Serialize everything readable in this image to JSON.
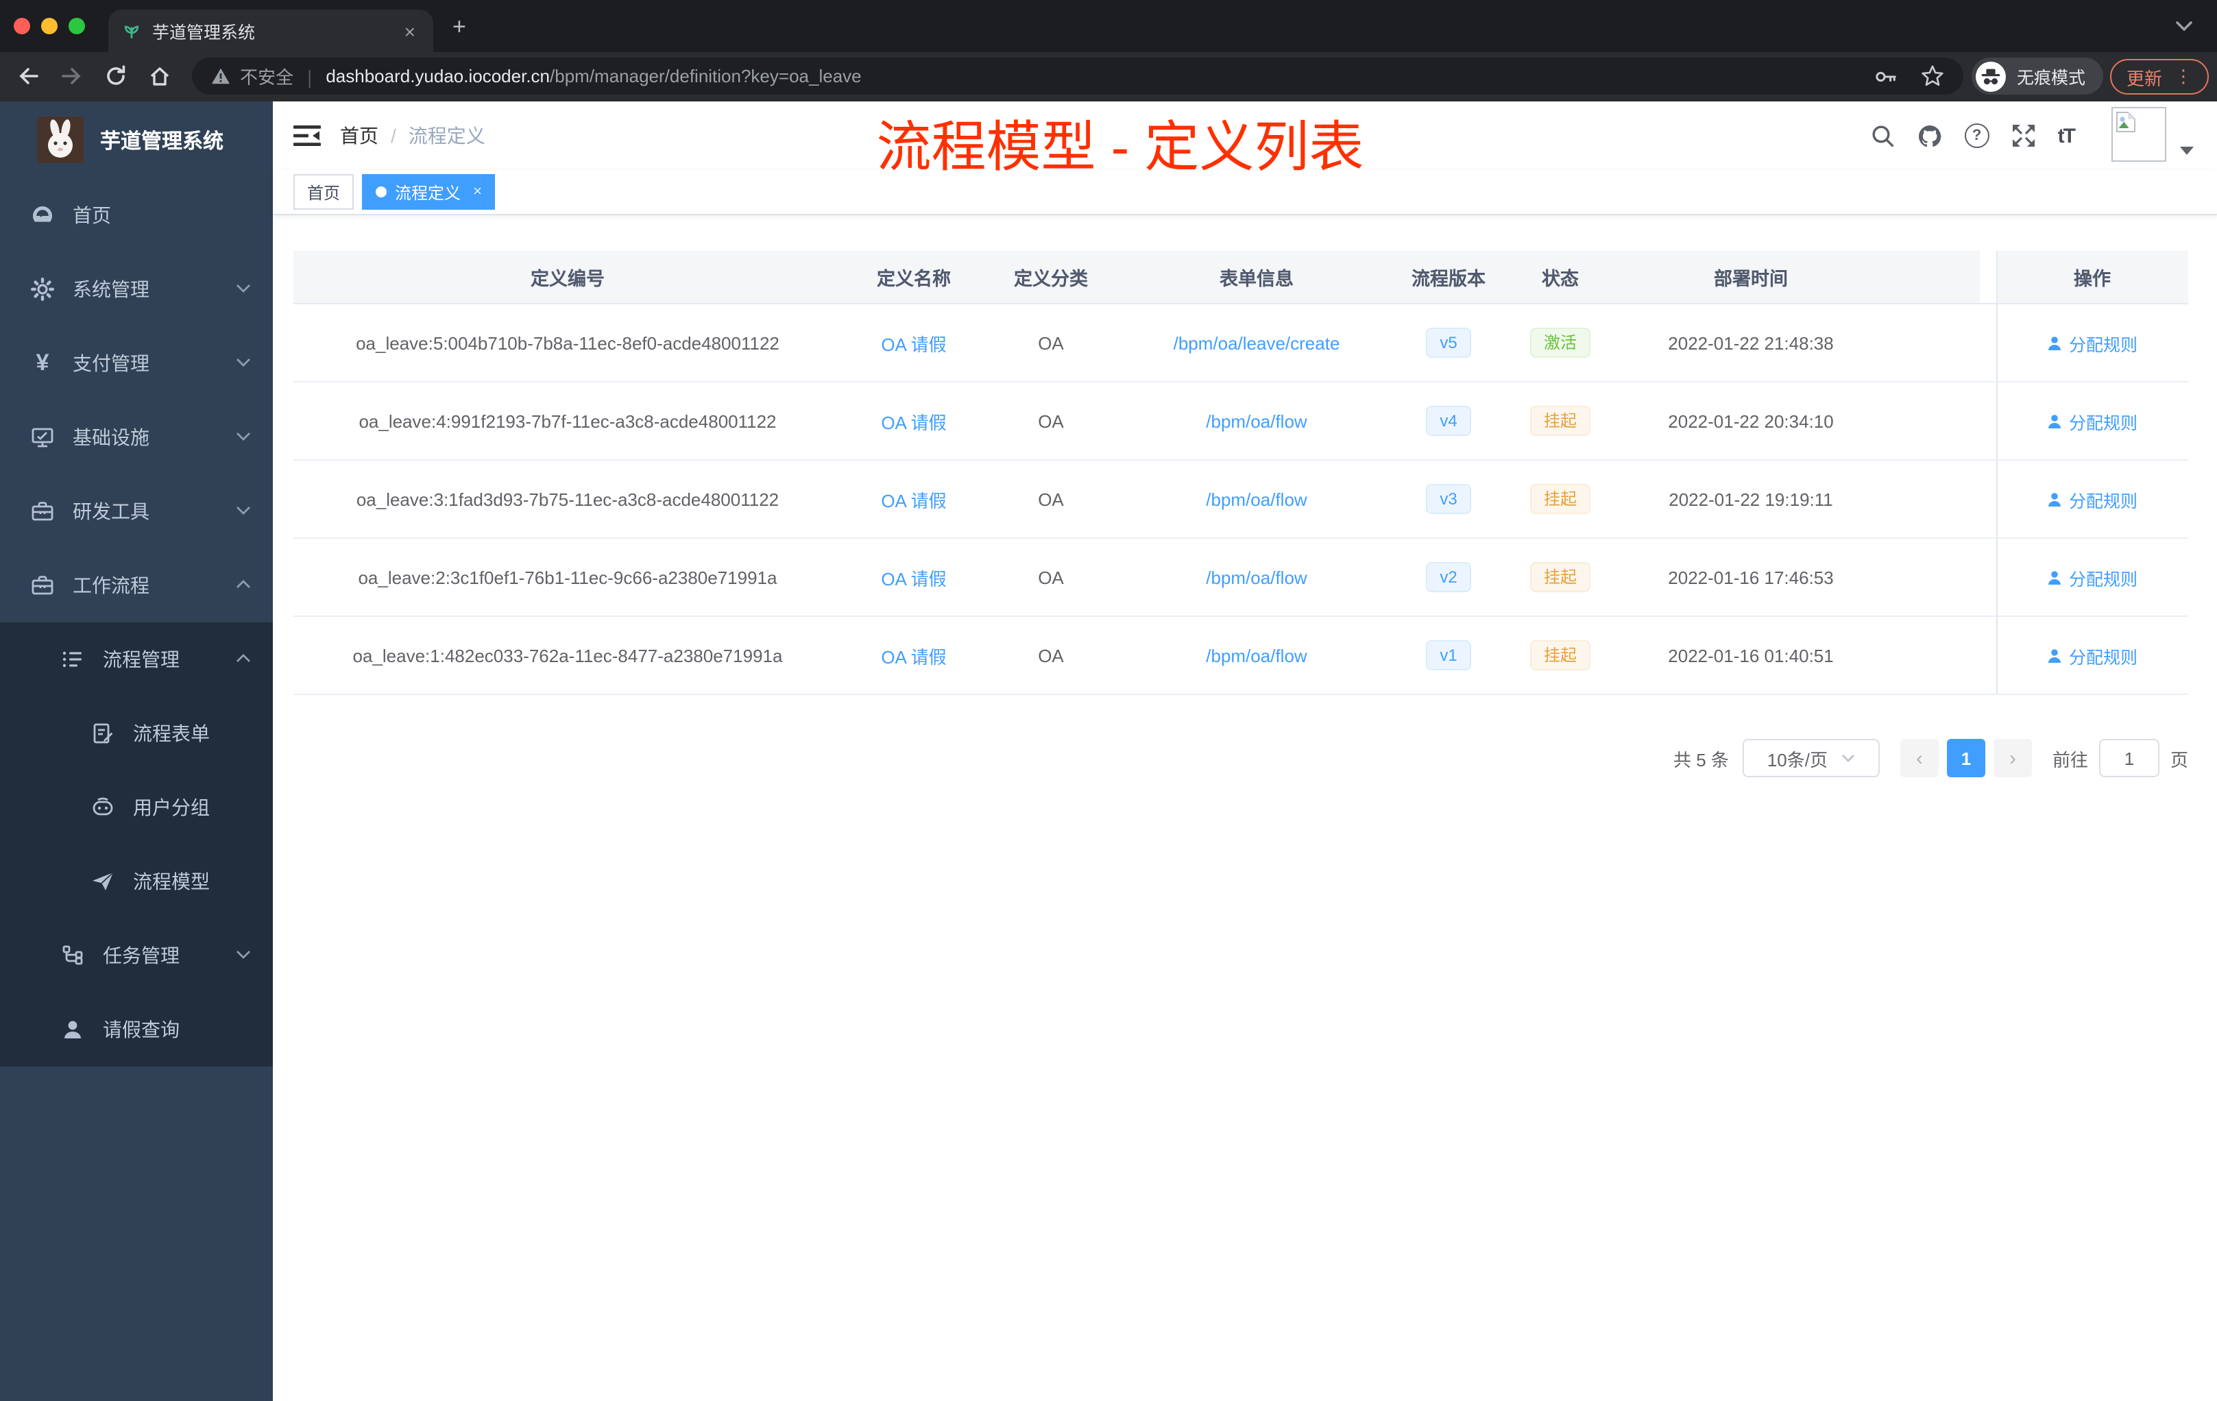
{
  "browser": {
    "tab_title": "芋道管理系统",
    "new_tab": "+",
    "tab_close": "×",
    "address": {
      "security_label": "不安全",
      "divider": "|",
      "domain": "dashboard.yudao.iocoder.cn",
      "path": "/bpm/manager/definition?key=oa_leave"
    },
    "incognito_label": "无痕模式",
    "update_label": "更新",
    "menu_dots": "⋮"
  },
  "sidebar": {
    "logo_title": "芋道管理系统",
    "items": [
      {
        "label": "首页",
        "icon": "dashboard-icon"
      },
      {
        "label": "系统管理",
        "icon": "gear-icon"
      },
      {
        "label": "支付管理",
        "icon": "yen-icon"
      },
      {
        "label": "基础设施",
        "icon": "monitor-icon"
      },
      {
        "label": "研发工具",
        "icon": "toolbox-icon"
      },
      {
        "label": "工作流程",
        "icon": "briefcase-icon"
      },
      {
        "label": "流程管理",
        "icon": "list-icon"
      },
      {
        "label": "流程表单",
        "icon": "form-icon"
      },
      {
        "label": "用户分组",
        "icon": "group-icon"
      },
      {
        "label": "流程模型",
        "icon": "send-icon"
      },
      {
        "label": "任务管理",
        "icon": "tree-icon"
      },
      {
        "label": "请假查询",
        "icon": "user-icon"
      }
    ],
    "yen_glyph": "¥"
  },
  "header": {
    "breadcrumb": [
      "首页",
      "流程定义"
    ],
    "breadcrumb_sep": "/",
    "annotation": "流程模型 - 定义列表",
    "font_icon_label": "tT",
    "help_glyph": "?"
  },
  "tags": {
    "home": "首页",
    "active": "流程定义",
    "close": "×"
  },
  "table": {
    "columns": [
      "定义编号",
      "定义名称",
      "定义分类",
      "表单信息",
      "流程版本",
      "状态",
      "部署时间",
      "操作"
    ],
    "rows": [
      {
        "id": "oa_leave:5:004b710b-7b8a-11ec-8ef0-acde48001122",
        "name": "OA 请假",
        "category": "OA",
        "form": "/bpm/oa/leave/create",
        "version": "v5",
        "status": "激活",
        "time": "2022-01-22 21:48:38",
        "action": "分配规则"
      },
      {
        "id": "oa_leave:4:991f2193-7b7f-11ec-a3c8-acde48001122",
        "name": "OA 请假",
        "category": "OA",
        "form": "/bpm/oa/flow",
        "version": "v4",
        "status": "挂起",
        "time": "2022-01-22 20:34:10",
        "action": "分配规则"
      },
      {
        "id": "oa_leave:3:1fad3d93-7b75-11ec-a3c8-acde48001122",
        "name": "OA 请假",
        "category": "OA",
        "form": "/bpm/oa/flow",
        "version": "v3",
        "status": "挂起",
        "time": "2022-01-22 19:19:11",
        "action": "分配规则"
      },
      {
        "id": "oa_leave:2:3c1f0ef1-76b1-11ec-9c66-a2380e71991a",
        "name": "OA 请假",
        "category": "OA",
        "form": "/bpm/oa/flow",
        "version": "v2",
        "status": "挂起",
        "time": "2022-01-16 17:46:53",
        "action": "分配规则"
      },
      {
        "id": "oa_leave:1:482ec033-762a-11ec-8477-a2380e71991a",
        "name": "OA 请假",
        "category": "OA",
        "form": "/bpm/oa/flow",
        "version": "v1",
        "status": "挂起",
        "time": "2022-01-16 01:40:51",
        "action": "分配规则"
      }
    ]
  },
  "pagination": {
    "total": "共 5 条",
    "page_size": "10条/页",
    "prev": "‹",
    "next": "›",
    "current_page": "1",
    "goto_label": "前往",
    "goto_value": "1",
    "page_label": "页"
  },
  "colors": {
    "accent": "#409eff",
    "success": "#67c23a",
    "warning": "#e6a23c",
    "annotation_red": "#ff3000",
    "sidebar_bg": "#304156",
    "submenu_bg": "#1f2d3d"
  }
}
